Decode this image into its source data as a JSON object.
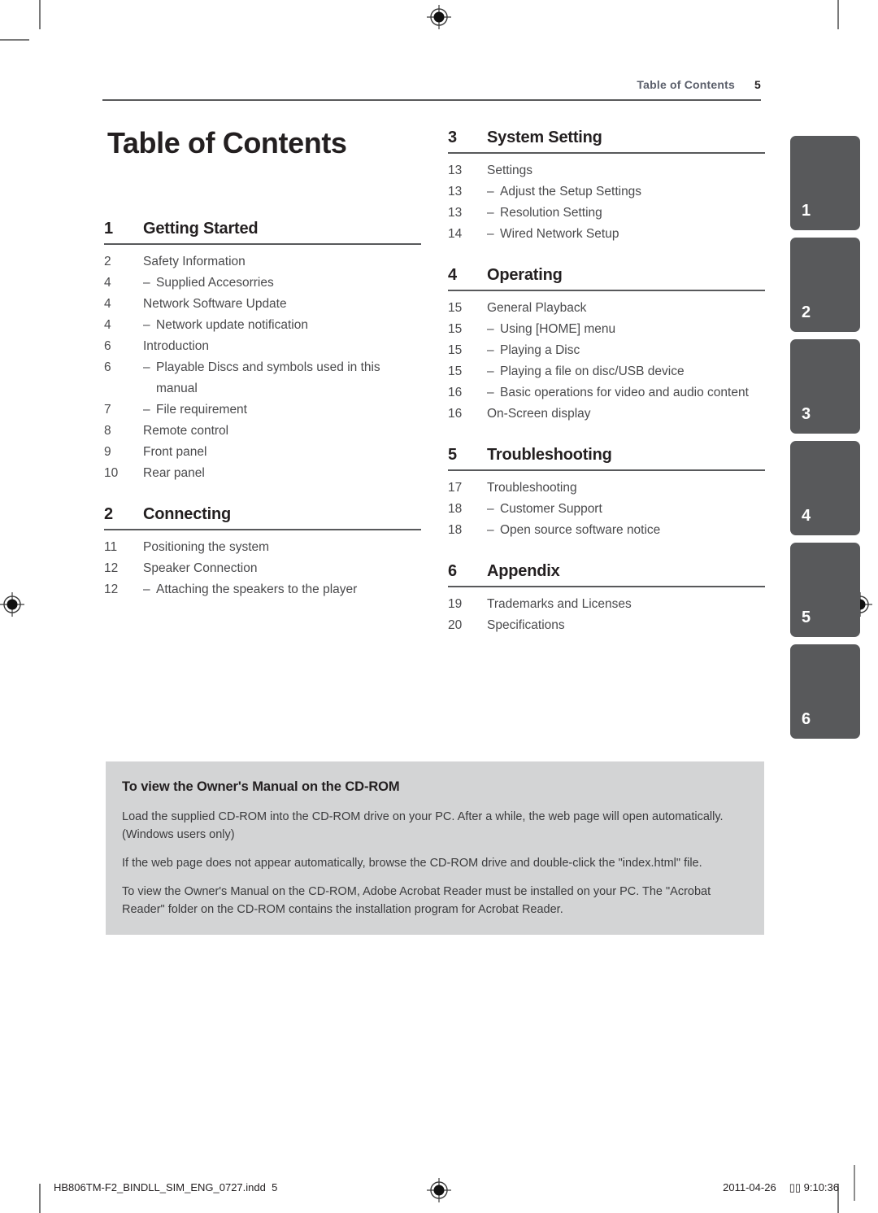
{
  "header": {
    "running_title": "Table of Contents",
    "page_number": "5"
  },
  "page_title": "Table of Contents",
  "columns": {
    "left": [
      {
        "number": "1",
        "title": "Getting Started",
        "entries": [
          {
            "page": "2",
            "label": "Safety Information",
            "sub": false
          },
          {
            "page": "4",
            "label": "Supplied Accesorries",
            "sub": true
          },
          {
            "page": "4",
            "label": "Network Software Update",
            "sub": false
          },
          {
            "page": "4",
            "label": "Network update notification",
            "sub": true
          },
          {
            "page": "6",
            "label": "Introduction",
            "sub": false
          },
          {
            "page": "6",
            "label": "Playable Discs and symbols used in this manual",
            "sub": true
          },
          {
            "page": "7",
            "label": "File requirement",
            "sub": true
          },
          {
            "page": "8",
            "label": "Remote control",
            "sub": false
          },
          {
            "page": "9",
            "label": "Front panel",
            "sub": false
          },
          {
            "page": "10",
            "label": "Rear panel",
            "sub": false
          }
        ]
      },
      {
        "number": "2",
        "title": "Connecting",
        "entries": [
          {
            "page": "11",
            "label": "Positioning the system",
            "sub": false
          },
          {
            "page": "12",
            "label": "Speaker Connection",
            "sub": false
          },
          {
            "page": "12",
            "label": "Attaching the speakers to the player",
            "sub": true
          }
        ]
      }
    ],
    "right": [
      {
        "number": "3",
        "title": "System Setting",
        "entries": [
          {
            "page": "13",
            "label": "Settings",
            "sub": false
          },
          {
            "page": "13",
            "label": "Adjust the Setup Settings",
            "sub": true
          },
          {
            "page": "13",
            "label": "Resolution Setting",
            "sub": true
          },
          {
            "page": "14",
            "label": "Wired Network Setup",
            "sub": true
          }
        ]
      },
      {
        "number": "4",
        "title": "Operating",
        "entries": [
          {
            "page": "15",
            "label": "General Playback",
            "sub": false
          },
          {
            "page": "15",
            "label": "Using [HOME] menu",
            "sub": true
          },
          {
            "page": "15",
            "label": "Playing a Disc",
            "sub": true
          },
          {
            "page": "15",
            "label": "Playing a file on disc/USB device",
            "sub": true
          },
          {
            "page": "16",
            "label": "Basic operations for video and audio content",
            "sub": true
          },
          {
            "page": "16",
            "label": "On-Screen display",
            "sub": false
          }
        ]
      },
      {
        "number": "5",
        "title": "Troubleshooting",
        "entries": [
          {
            "page": "17",
            "label": "Troubleshooting",
            "sub": false
          },
          {
            "page": "18",
            "label": "Customer Support",
            "sub": true
          },
          {
            "page": "18",
            "label": "Open source software notice",
            "sub": true
          }
        ]
      },
      {
        "number": "6",
        "title": "Appendix",
        "entries": [
          {
            "page": "19",
            "label": "Trademarks and Licenses",
            "sub": false
          },
          {
            "page": "20",
            "label": "Specifications",
            "sub": false
          }
        ]
      }
    ]
  },
  "note": {
    "heading": "To view the Owner's Manual on the CD-ROM",
    "paragraphs": [
      "Load the supplied CD-ROM into the CD-ROM drive on your PC. After a while, the web page will open automatically. (Windows users only)",
      "If the web page does not appear automatically, browse the CD-ROM drive and double-click the \"index.html\" file.",
      "To view the Owner's Manual on the CD-ROM, Adobe Acrobat Reader must be installed on your PC. The \"Acrobat Reader\" folder on the CD-ROM contains the installation program for Acrobat Reader."
    ]
  },
  "chapter_tabs": [
    "1",
    "2",
    "3",
    "4",
    "5",
    "6"
  ],
  "footer": {
    "file_name": "HB806TM-F2_BINDLL_SIM_ENG_0727.indd",
    "file_page": "5",
    "date": "2011-04-26",
    "time_marker": "▯▯",
    "time": "9:10:36"
  },
  "colors": {
    "rule": "#58595b",
    "note_background": "#d3d4d5",
    "tab_background": "#58595b",
    "header_text": "#5b5f6b",
    "body_text": "#4a4a4c"
  }
}
